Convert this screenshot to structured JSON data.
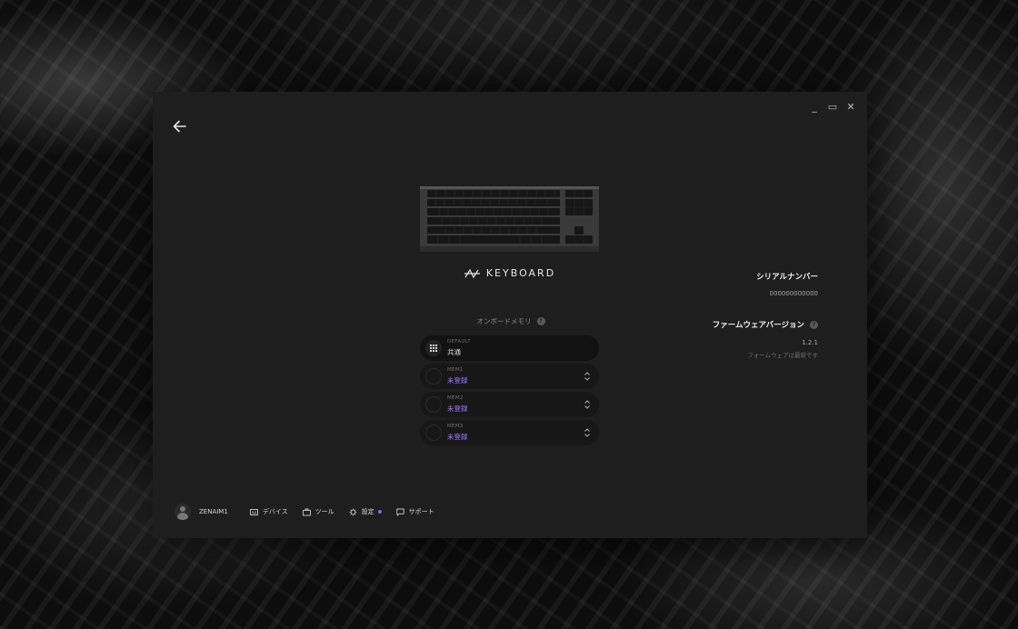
{
  "window_controls": {
    "minimize": "_",
    "maximize": "▭",
    "close": "✕"
  },
  "device": {
    "brand_name": "KEYBOARD"
  },
  "onboard_memory": {
    "title": "オンボードメモリ",
    "help": "?",
    "slots": [
      {
        "label": "DEFAULT",
        "value": "共通"
      },
      {
        "label": "MEM1",
        "value": "未登録"
      },
      {
        "label": "MEM2",
        "value": "未登録"
      },
      {
        "label": "MEM3",
        "value": "未登録"
      }
    ]
  },
  "serial": {
    "title": "シリアルナンバー",
    "value": "000000000000"
  },
  "firmware": {
    "title": "ファームウェアバージョン",
    "help": "?",
    "version": "1.2.1",
    "status": "フォームウェアは最新です"
  },
  "footer": {
    "username": "ZENAIM1",
    "nav": [
      {
        "label": "デバイス",
        "icon": "device-icon"
      },
      {
        "label": "ツール",
        "icon": "tool-icon"
      },
      {
        "label": "設定",
        "icon": "gear-icon"
      },
      {
        "label": "サポート",
        "icon": "chat-icon"
      }
    ]
  },
  "colors": {
    "accent": "#9a7bff",
    "window_bg": "#1e1e1e"
  }
}
